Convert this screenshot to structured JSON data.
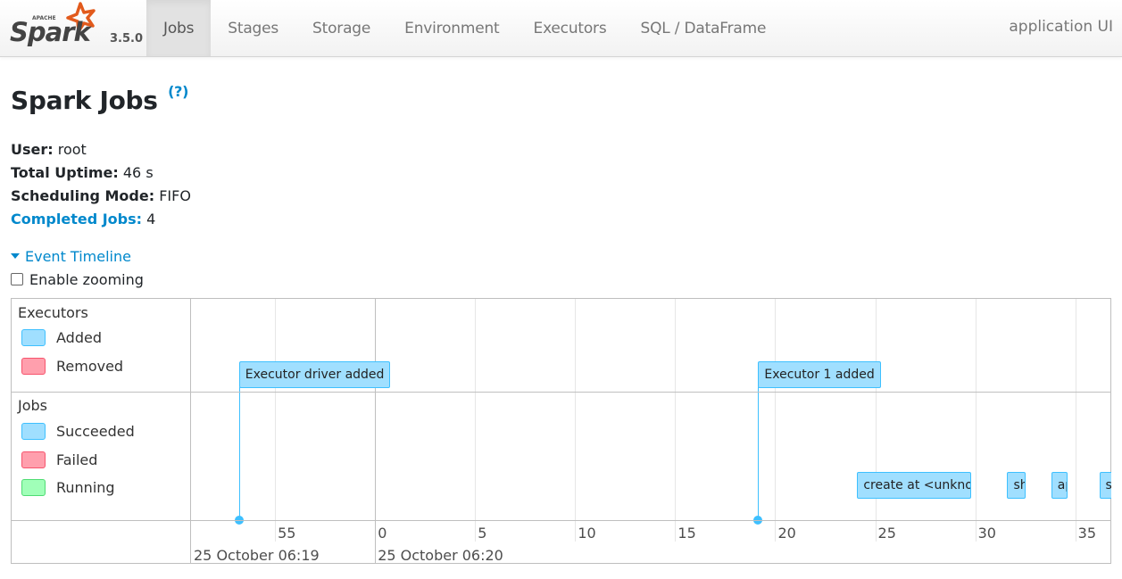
{
  "navbar": {
    "brand": {
      "apache": "APACHE",
      "name": "Spark",
      "version": "3.5.0"
    },
    "tabs": [
      {
        "label": "Jobs",
        "active": true
      },
      {
        "label": "Stages",
        "active": false
      },
      {
        "label": "Storage",
        "active": false
      },
      {
        "label": "Environment",
        "active": false
      },
      {
        "label": "Executors",
        "active": false
      },
      {
        "label": "SQL / DataFrame",
        "active": false
      }
    ],
    "app_title": "application UI"
  },
  "page": {
    "title": "Spark Jobs",
    "help": "(?)",
    "summary": {
      "user_label": "User:",
      "user": "root",
      "uptime_label": "Total Uptime:",
      "uptime": "46 s",
      "mode_label": "Scheduling Mode:",
      "mode": "FIFO",
      "completed_label": "Completed Jobs:",
      "completed": "4"
    },
    "timeline_toggle": "Event Timeline",
    "enable_zooming": {
      "label": "Enable zooming",
      "checked": false
    }
  },
  "timeline": {
    "colors": {
      "added": "#a0dfff",
      "removed": "#ff9fad",
      "running": "#a0ffb8",
      "border_blue": "#3ec0ff"
    },
    "legend": {
      "executors": {
        "title": "Executors",
        "items": [
          "Added",
          "Removed"
        ]
      },
      "jobs": {
        "title": "Jobs",
        "items": [
          "Succeeded",
          "Failed",
          "Running"
        ]
      }
    },
    "axis": {
      "start_seconds": -9.2,
      "end_seconds": 36.8,
      "minor_ticks": [
        {
          "t": -5,
          "label": "55"
        },
        {
          "t": 0,
          "label": "0"
        },
        {
          "t": 5,
          "label": "5"
        },
        {
          "t": 10,
          "label": "10"
        },
        {
          "t": 15,
          "label": "15"
        },
        {
          "t": 20,
          "label": "20"
        },
        {
          "t": 25,
          "label": "25"
        },
        {
          "t": 30,
          "label": "30"
        },
        {
          "t": 35,
          "label": "35"
        }
      ],
      "major_labels": [
        {
          "t": -9.2,
          "label": "25 October 06:19"
        },
        {
          "t": 0,
          "label": "25 October 06:20"
        }
      ]
    },
    "executor_events": [
      {
        "label": "Executor driver added",
        "t": -6.8,
        "status": "added"
      },
      {
        "label": "Executor 1 added",
        "t": 19.15,
        "status": "added"
      }
    ],
    "jobs": [
      {
        "label": "create at <unknown>",
        "start": 24.1,
        "end": 29.8,
        "status": "succeeded"
      },
      {
        "label": "show",
        "start": 31.6,
        "end": 32.5,
        "status": "succeeded"
      },
      {
        "label": "apply",
        "start": 33.8,
        "end": 34.6,
        "status": "succeeded"
      },
      {
        "label": "show",
        "start": 36.2,
        "end": 37.1,
        "status": "succeeded"
      }
    ]
  }
}
